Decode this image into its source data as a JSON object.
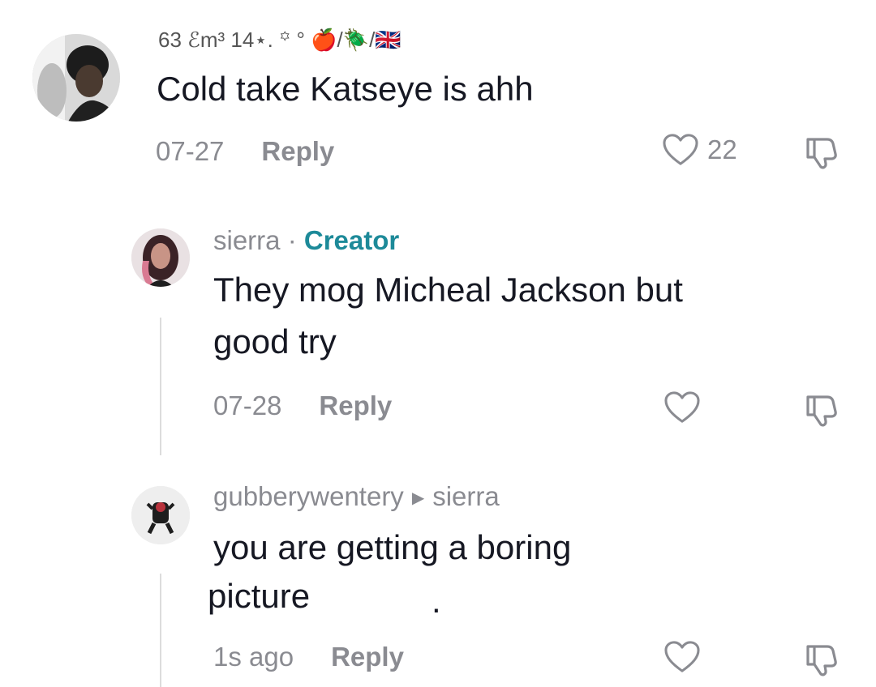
{
  "comments": [
    {
      "username_display": "63 ℰm³ 14⋆. ꙳ ° 🍎/🪲/🇬🇧",
      "text": "Cold take Katseye is ahh",
      "date": "07-27",
      "reply_label": "Reply",
      "likes": "22",
      "avatar": "person-photo-avatar"
    },
    {
      "username": "sierra",
      "separator": "·",
      "badge": "Creator",
      "text_line1": "They mog Micheal Jackson but",
      "text_line2": "good try",
      "date": "07-28",
      "reply_label": "Reply",
      "avatar": "woman-photo-avatar"
    },
    {
      "username": "gubberywentery",
      "reply_to": "sierra",
      "text_line1": "you are getting a boring",
      "text_line2": "picture",
      "text_dot": ".",
      "date": "1s ago",
      "reply_label": "Reply",
      "avatar": "character-avatar"
    }
  ],
  "colors": {
    "text": "#161823",
    "muted": "#8a8b91",
    "creator": "#1d8a99"
  }
}
